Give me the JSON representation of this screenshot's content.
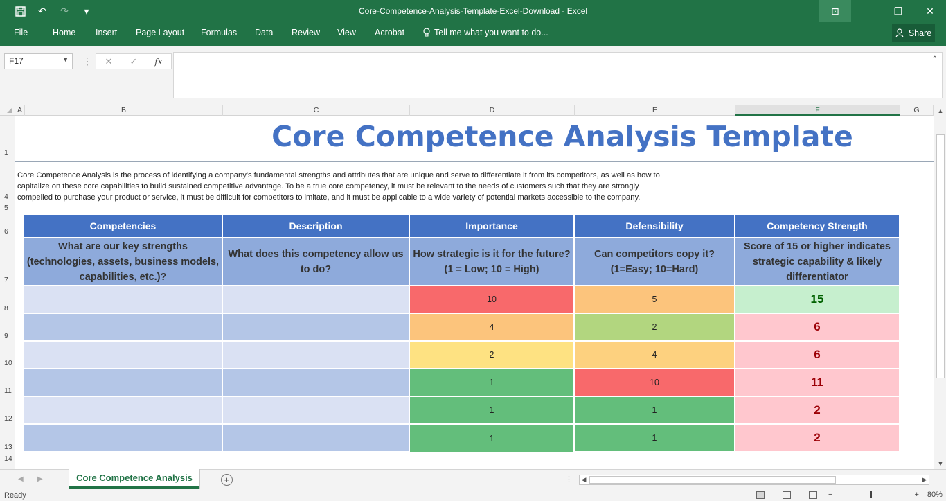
{
  "window": {
    "title": "Core-Competence-Analysis-Template-Excel-Download - Excel",
    "controls": {
      "ribbon_display": "⊡",
      "minimize": "—",
      "restore": "❐",
      "close": "✕"
    }
  },
  "quick_access": {
    "save": "💾",
    "undo": "↶",
    "redo": "↷",
    "customize": "▾"
  },
  "ribbon": {
    "tabs": [
      "File",
      "Home",
      "Insert",
      "Page Layout",
      "Formulas",
      "Data",
      "Review",
      "View",
      "Acrobat"
    ],
    "tell_me": "Tell me what you want to do...",
    "share": "Share"
  },
  "formula_bar": {
    "name_box": "F17",
    "cancel": "✕",
    "enter": "✓",
    "fx": "fx",
    "value": ""
  },
  "columns": [
    "A",
    "B",
    "C",
    "D",
    "E",
    "F",
    "G"
  ],
  "rows": [
    "1",
    "4",
    "5",
    "6",
    "7",
    "8",
    "9",
    "10",
    "11",
    "12",
    "13",
    "14"
  ],
  "sheet": {
    "title": "Core Competence Analysis Template",
    "intro_lines": [
      "Core Competence Analysis is the process of identifying a company's fundamental strengths and attributes that are unique and serve to differentiate it from its competitors, as well as how to",
      "capitalize on these core capabilities to build sustained competitive advantage. To be a true core competency, it must be relevant to the needs of customers such that they are strongly",
      "compelled to purchase your product or service, it must be difficult for competitors to imitate, and it must be applicable to a wide variety of potential markets accessible to the company."
    ],
    "headers": [
      "Competencies",
      "Description",
      "Importance",
      "Defensibility",
      "Competency Strength"
    ],
    "subheaders": [
      "What are our key strengths (technologies, assets, business models, capabilities, etc.)?",
      "What does this competency allow us to do?",
      "How strategic is it for the future? (1 = Low; 10 = High)",
      "Can competitors copy it? (1=Easy; 10=Hard)",
      "Score of 15 or higher indicates strategic capability & likely differentiator"
    ],
    "rows": [
      {
        "competency": "",
        "description": "",
        "importance": "10",
        "defensibility": "5",
        "strength": "15"
      },
      {
        "competency": "",
        "description": "",
        "importance": "4",
        "defensibility": "2",
        "strength": "6"
      },
      {
        "competency": "",
        "description": "",
        "importance": "2",
        "defensibility": "4",
        "strength": "6"
      },
      {
        "competency": "",
        "description": "",
        "importance": "1",
        "defensibility": "10",
        "strength": "11"
      },
      {
        "competency": "",
        "description": "",
        "importance": "1",
        "defensibility": "1",
        "strength": "2"
      },
      {
        "competency": "",
        "description": "",
        "importance": "1",
        "defensibility": "1",
        "strength": "2"
      }
    ],
    "colors": {
      "header": "#4472c4",
      "subheader": "#8eaadb",
      "row_light": "#dae1f3",
      "row_dark": "#b4c6e7",
      "score_red": "#f8696b",
      "score_orange": "#fcc47c",
      "score_yellow": "#fee282",
      "score_lightgreen": "#b2d67f",
      "score_green": "#63be7b",
      "strength_good_bg": "#c6efce",
      "strength_good_text": "#006100",
      "strength_bad_bg": "#ffc7ce",
      "strength_bad_text": "#9c0006"
    }
  },
  "sheet_tabs": {
    "active": "Core Competence Analysis",
    "add": "+"
  },
  "status": {
    "text": "Ready",
    "zoom": "80%",
    "zoom_out": "−",
    "zoom_in": "+"
  }
}
